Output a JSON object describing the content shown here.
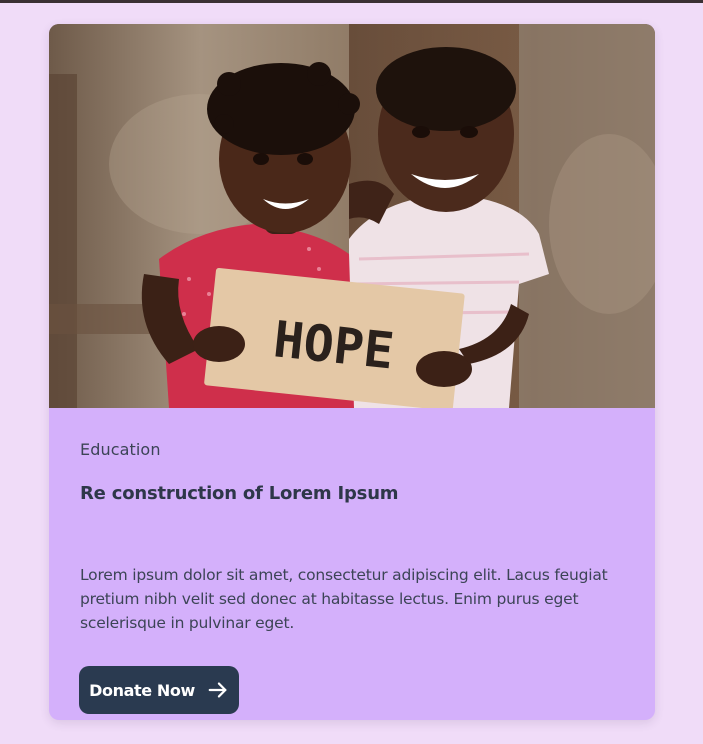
{
  "card": {
    "image": {
      "subject": "two smiling children holding a cardboard sign",
      "sign_text": "HOPE"
    },
    "category": "Education",
    "title": "Re construction of Lorem Ipsum",
    "description": "Lorem ipsum dolor sit amet, consectetur adipiscing elit. Lacus feugiat pretium nibh velit sed donec at habitasse lectus. Enim purus eget scelerisque in pulvinar eget.",
    "button": {
      "label": "Donate Now",
      "icon": "arrow-right-icon"
    }
  },
  "colors": {
    "page_background": "#f0dcf8",
    "card_background": "#d4b0fb",
    "button_background": "#2a3a50",
    "text": "#3c4456"
  }
}
